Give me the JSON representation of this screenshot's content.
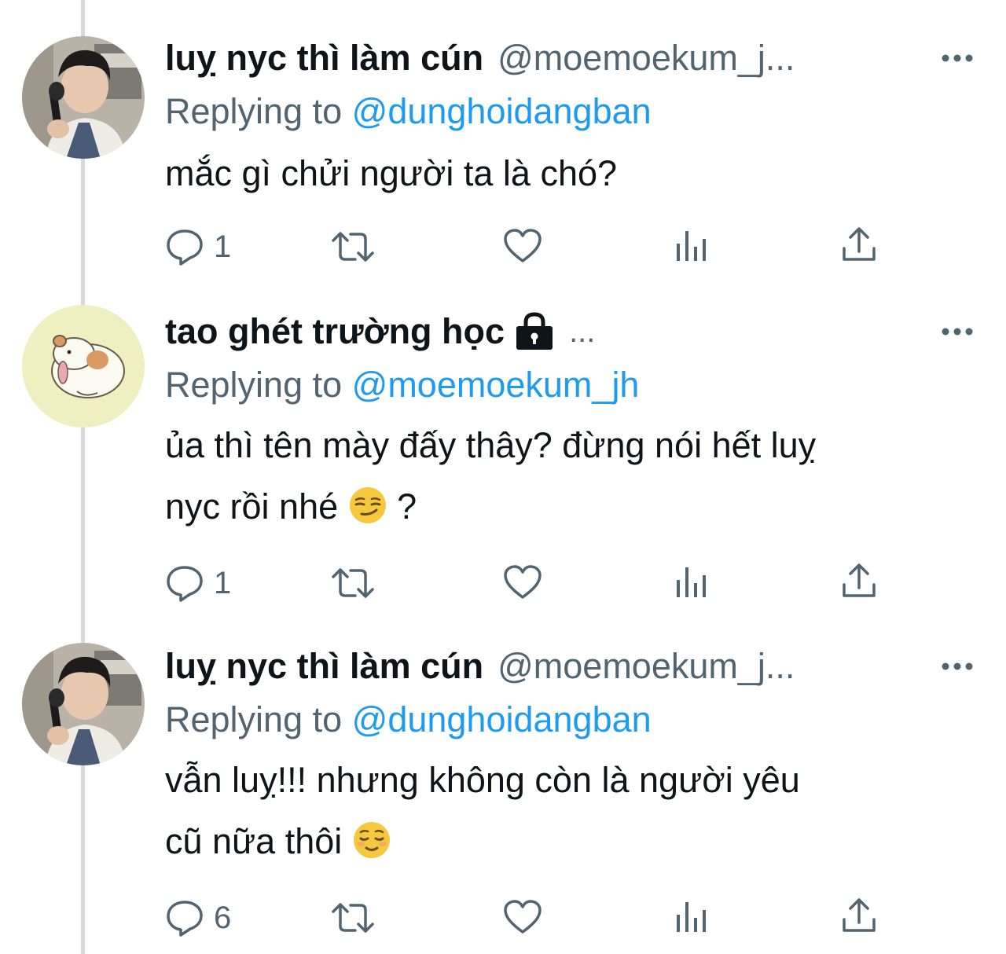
{
  "tweets": [
    {
      "display_name": "luỵ nyc thì làm cún",
      "handle": "@moemoekum_j...",
      "replying_prefix": "Replying to ",
      "replying_to": "@dunghoidangban",
      "text_lines": [
        "mắc gì chửi người ta là chó?"
      ],
      "emoji": "",
      "emoji_after": "",
      "reply_count": "1",
      "avatar": "person-with-microphone-avatar"
    },
    {
      "display_name": "tao ghét trường học",
      "locked_icon": "lock-icon",
      "header_ellipsis": "...",
      "replying_prefix": "Replying to ",
      "replying_to": "@moemoekum_jh",
      "text_lines": [
        "ủa thì tên mày đấy thây? đừng nói hết luỵ",
        "nyc rồi nhé"
      ],
      "emoji": "smirking-face",
      "emoji_after": " ?",
      "reply_count": "1",
      "avatar": "hamster-avatar"
    },
    {
      "display_name": "luỵ nyc thì làm cún",
      "handle": "@moemoekum_j...",
      "replying_prefix": "Replying to ",
      "replying_to": "@dunghoidangban",
      "text_lines": [
        "vẫn luỵ!!! nhưng không còn là người yêu",
        "cũ nữa thôi"
      ],
      "emoji": "relieved-face",
      "emoji_after": "",
      "reply_count": "6",
      "avatar": "person-with-microphone-avatar"
    }
  ],
  "colors": {
    "text_primary": "#0f1419",
    "text_secondary": "#536471",
    "mention": "#1d9bf0",
    "thread_line": "#d6dadf"
  },
  "icons": {
    "reply": "reply-icon",
    "retweet": "retweet-icon",
    "like": "like-icon",
    "views": "views-icon",
    "share": "share-icon",
    "more": "more-icon"
  }
}
